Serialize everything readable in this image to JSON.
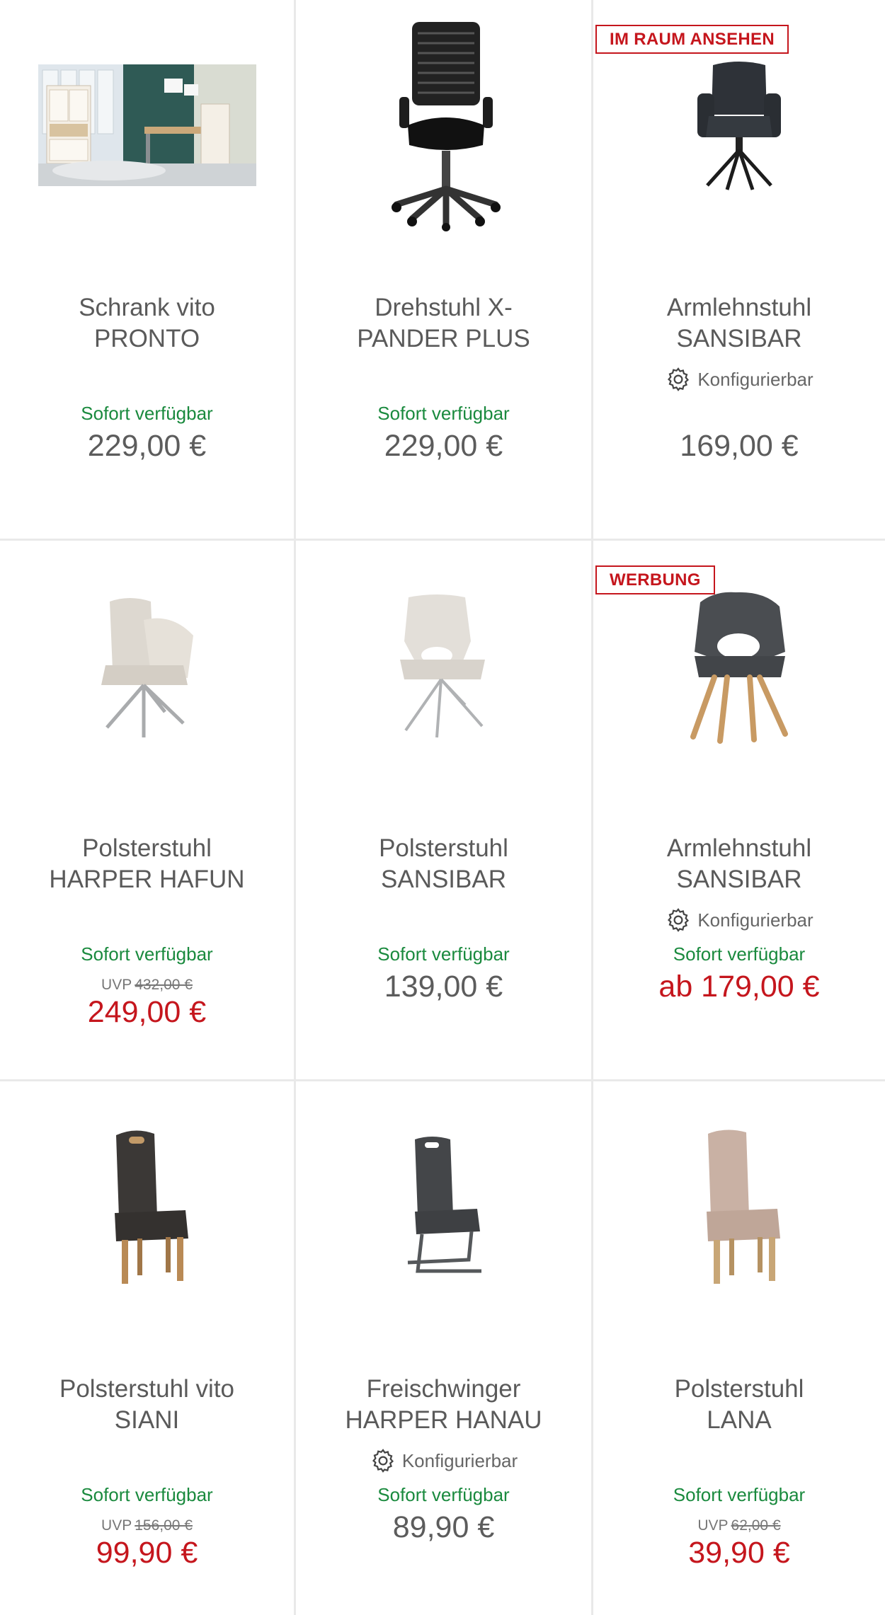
{
  "products": [
    {
      "name_line1": "Schrank vito",
      "name_line2": "PRONTO",
      "availability": "Sofort verfügbar",
      "price": "229,00 €"
    },
    {
      "name_line1": "Drehstuhl X-",
      "name_line2": "PANDER PLUS",
      "availability": "Sofort verfügbar",
      "price": "229,00 €"
    },
    {
      "badge": "IM RAUM ANSEHEN",
      "name_line1": "Armlehnstuhl",
      "name_line2": "SANSIBAR",
      "configurable": "Konfigurierbar",
      "price": "169,00 €"
    },
    {
      "name_line1": "Polsterstuhl",
      "name_line2": "HARPER HAFUN",
      "availability": "Sofort verfügbar",
      "uvp_label": "UVP",
      "uvp": "432,00 €",
      "price": "249,00 €"
    },
    {
      "name_line1": "Polsterstuhl",
      "name_line2": "SANSIBAR",
      "availability": "Sofort verfügbar",
      "price": "139,00 €"
    },
    {
      "badge": "WERBUNG",
      "name_line1": "Armlehnstuhl",
      "name_line2": "SANSIBAR",
      "configurable": "Konfigurierbar",
      "availability": "Sofort verfügbar",
      "price": "ab 179,00 €"
    },
    {
      "name_line1": "Polsterstuhl vito",
      "name_line2": "SIANI",
      "availability": "Sofort verfügbar",
      "uvp_label": "UVP",
      "uvp": "156,00 €",
      "price": "99,90 €"
    },
    {
      "name_line1": "Freischwinger",
      "name_line2": "HARPER HANAU",
      "configurable": "Konfigurierbar",
      "availability": "Sofort verfügbar",
      "price": "89,90 €"
    },
    {
      "name_line1": "Polsterstuhl",
      "name_line2": "LANA",
      "availability": "Sofort verfügbar",
      "uvp_label": "UVP",
      "uvp": "62,00 €",
      "price": "39,90 €"
    }
  ],
  "colors": {
    "available": "#1a8a3e",
    "sale": "#c5161d",
    "badge": "#c5161d",
    "text": "#5a5a5a"
  },
  "icons": {
    "configurable": "gear-icon",
    "color_variants": "color-swatch-icon"
  }
}
